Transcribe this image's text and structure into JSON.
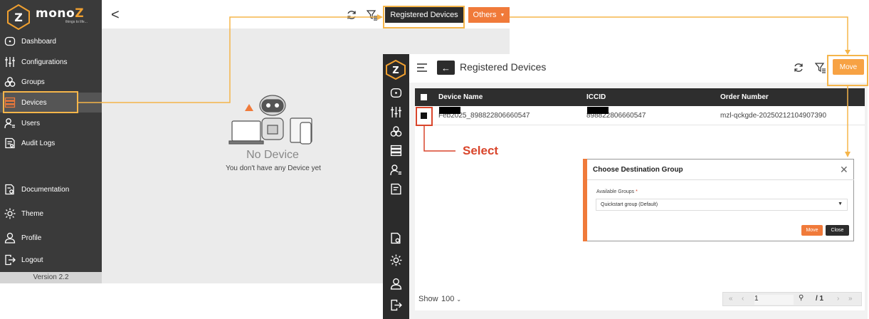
{
  "app": {
    "logo_text": "mono",
    "logo_suffix": "Z",
    "logo_tagline": "things to life..."
  },
  "sidebar": {
    "items": [
      {
        "label": "Dashboard",
        "icon": "dashboard-icon"
      },
      {
        "label": "Configurations",
        "icon": "sliders-icon"
      },
      {
        "label": "Groups",
        "icon": "groups-icon"
      },
      {
        "label": "Devices",
        "icon": "devices-icon"
      },
      {
        "label": "Users",
        "icon": "users-icon"
      },
      {
        "label": "Audit Logs",
        "icon": "audit-logs-icon"
      }
    ],
    "bottom_items": [
      {
        "label": "Documentation",
        "icon": "documentation-icon"
      },
      {
        "label": "Theme",
        "icon": "sun-icon"
      },
      {
        "label": "Profile",
        "icon": "profile-icon"
      },
      {
        "label": "Logout",
        "icon": "logout-icon"
      }
    ],
    "version": "Version 2.2"
  },
  "left_page": {
    "back": "<",
    "registered_devices_label": "Registered Devices",
    "others_label": "Others",
    "empty_title": "No Device",
    "empty_subtitle": "You don't have any Device yet"
  },
  "right_page": {
    "title": "Registered Devices",
    "move_label": "Move",
    "columns": [
      "Device Name",
      "ICCID",
      "Order Number"
    ],
    "rows": [
      {
        "device_name": "Feb2025_898822806660547",
        "iccid": "898822806660547",
        "order_number": "mzl-qckgde-20250212104907390"
      }
    ],
    "show_label": "Show",
    "page_size": "100",
    "page_current": "1",
    "page_total": "/ 1"
  },
  "modal": {
    "title": "Choose Destination Group",
    "field_label": "Available Groups",
    "required_mark": "*",
    "selected_group": "Quickstart group (Default)",
    "move_label": "Move",
    "close_label": "Close"
  },
  "annotation": {
    "select_label": "Select"
  },
  "colors": {
    "accent": "#f07a3a",
    "highlight": "#f5b54a",
    "annotation_red": "#d9452b",
    "sidebar": "#3a3a3a"
  }
}
